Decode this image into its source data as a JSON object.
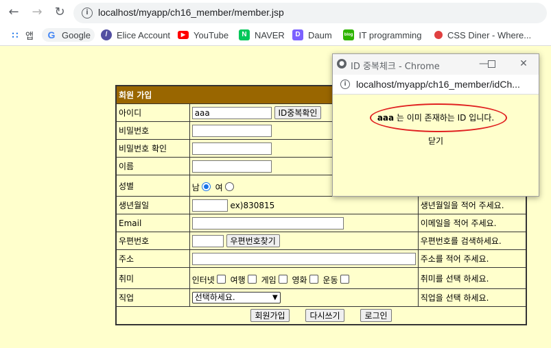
{
  "browser": {
    "url": "localhost/myapp/ch16_member/member.jsp",
    "bookmarks": [
      {
        "icon": "apps-grid-icon",
        "label": "앱"
      },
      {
        "icon": "google-icon",
        "label": "Google"
      },
      {
        "icon": "elice-icon",
        "label": "Elice Account"
      },
      {
        "icon": "youtube-icon",
        "label": "YouTube"
      },
      {
        "icon": "naver-icon",
        "label": "NAVER"
      },
      {
        "icon": "daum-icon",
        "label": "Daum"
      },
      {
        "icon": "blog-icon",
        "label": "IT programming"
      },
      {
        "icon": "css-diner-icon",
        "label": "CSS Diner - Where..."
      }
    ]
  },
  "form": {
    "header": "회원 가입",
    "rows": {
      "id": {
        "label": "아이디",
        "value": "aaa",
        "button": "ID중복확인"
      },
      "password": {
        "label": "비밀번호"
      },
      "password_confirm": {
        "label": "비밀번호 확인"
      },
      "name": {
        "label": "이름"
      },
      "gender": {
        "label": "성별",
        "male": "남",
        "female": "여",
        "selected": "남"
      },
      "birthday": {
        "label": "생년월일",
        "example": "ex)830815",
        "hint": "생년월일을 적어 주세요."
      },
      "email": {
        "label": "Email",
        "hint": "이메일을 적어 주세요."
      },
      "zipcode": {
        "label": "우편번호",
        "button": "우편번호찾기",
        "hint": "우편번호를 검색하세요."
      },
      "address": {
        "label": "주소",
        "hint": "주소를 적어 주세요."
      },
      "hobby": {
        "label": "취미",
        "options": [
          "인터넷",
          "여행",
          "게임",
          "영화",
          "운동"
        ],
        "hint": "취미를 선택 하세요."
      },
      "job": {
        "label": "직업",
        "selected": "선택하세요.",
        "hint": "직업을 선택 하세요."
      }
    },
    "buttons": {
      "submit": "회원가입",
      "reset": "다시쓰기",
      "login": "로그인"
    }
  },
  "popup": {
    "title": "ID 중복체크 - Chrome",
    "url": "localhost/myapp/ch16_member/idCh...",
    "message_id": "aaa",
    "message_text": " 는 이미 존재하는 ID 입니다.",
    "close_label": "닫기",
    "annotation_color": "#e02020"
  },
  "colors": {
    "page_bg": "#ffffcc",
    "header_bg": "#996600"
  }
}
